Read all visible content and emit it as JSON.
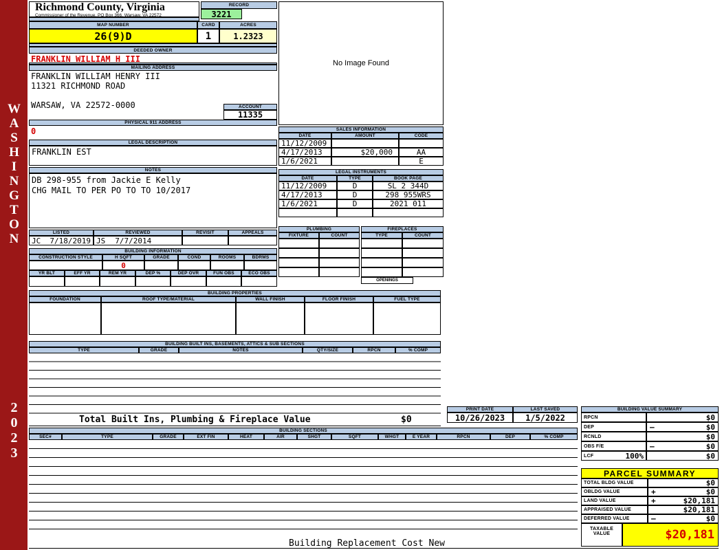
{
  "colors": {
    "header_blue": "#b8cce4",
    "record_green": "#9cf09c",
    "highlight_yellow": "#ffff00",
    "acres_cream": "#ffffcc",
    "sidebar_red": "#9b1717",
    "alert_red": "#d40000"
  },
  "sidebar": {
    "state": "WASHINGTON",
    "year": "2023"
  },
  "header": {
    "county": "Richmond County, Virginia",
    "commissioner": "Commissioner of the Revenue, PO Box 366, Warsaw, VA 22572"
  },
  "record": {
    "label": "RECORD",
    "value": "3221"
  },
  "map_number": {
    "label": "MAP NUMBER",
    "value": "26(9)D"
  },
  "card": {
    "label": "CARD",
    "value": "1"
  },
  "acres": {
    "label": "ACRES",
    "value": "1.2323"
  },
  "deeded_owner": {
    "label": "DEEDED OWNER",
    "value": "FRANKLIN WILLIAM H III"
  },
  "mailing_address": {
    "label": "MAILING ADDRESS",
    "line1": "FRANKLIN WILLIAM HENRY III",
    "line2": "11321 RICHMOND ROAD",
    "line3": "WARSAW, VA 22572-0000"
  },
  "account": {
    "label": "ACCOUNT",
    "value": "11335"
  },
  "physical_address": {
    "label": "PHYSICAL 911 ADDRESS",
    "value": "0"
  },
  "legal_description": {
    "label": "LEGAL DESCRIPTION",
    "value": "FRANKLIN EST"
  },
  "notes": {
    "label": "NOTES",
    "line1": "DB 298-955 from Jackie E Kelly",
    "line2": "CHG MAIL TO PER PO TO TO 10/2017"
  },
  "image_box": {
    "text": "No Image Found"
  },
  "sales": {
    "title": "SALES INFORMATION",
    "headers": [
      "DATE",
      "AMOUNT",
      "CODE"
    ],
    "rows": [
      {
        "date": "11/12/2009",
        "amount": "",
        "code": ""
      },
      {
        "date": "4/17/2013",
        "amount": "$20,000",
        "code": "AA"
      },
      {
        "date": "1/6/2021",
        "amount": "",
        "code": "E"
      }
    ]
  },
  "legal_instruments": {
    "title": "LEGAL INSTRUMENTS",
    "headers": [
      "DATE",
      "TYPE",
      "BOOK PAGE"
    ],
    "rows": [
      {
        "date": "11/12/2009",
        "type": "D",
        "book": "SL 2 344D"
      },
      {
        "date": "4/17/2013",
        "type": "D",
        "book": "298 955WRS"
      },
      {
        "date": "1/6/2021",
        "type": "D",
        "book": "2021 011"
      }
    ]
  },
  "plumbing": {
    "title": "PLUMBING",
    "headers": [
      "FIXTURE",
      "COUNT"
    ]
  },
  "fireplaces": {
    "title": "FIREPLACES",
    "headers": [
      "TYPE",
      "COUNT"
    ],
    "openings": "OPENINGS"
  },
  "inspection": {
    "headers": [
      "LISTED",
      "REVIEWED",
      "REVISIT",
      "APPEALS"
    ],
    "listed_by": "JC",
    "listed_date": "7/18/2019",
    "reviewed_by": "JS",
    "reviewed_date": "7/7/2014"
  },
  "building_information": {
    "title": "BUILDING INFORMATION",
    "row1_headers": [
      "CONSTRUCTION STYLE",
      "H SQFT",
      "GRADE",
      "COND",
      "ROOMS",
      "BDRMS"
    ],
    "h_sqft": "0",
    "row2_headers": [
      "YR BLT",
      "EFF YR",
      "REM YR",
      "DEP %",
      "DEP OVR",
      "FUN OBS",
      "ECO OBS"
    ]
  },
  "building_properties": {
    "title": "BUILDING PROPERTIES",
    "headers": [
      "FOUNDATION",
      "ROOF TYPE/MATERIAL",
      "WALL FINISH",
      "FLOOR FINISH",
      "FUEL TYPE"
    ]
  },
  "built_ins": {
    "title": "BUILDING BUILT INS, BASEMENTS, ATTICS & SUB SECTIONS",
    "headers": [
      "TYPE",
      "GRADE",
      "NOTES",
      "QTY/SIZE",
      "RPCN",
      "% COMP"
    ],
    "total_label": "Total Built Ins, Plumbing & Fireplace Value",
    "total_value": "$0"
  },
  "print_info": {
    "print_date_label": "PRINT DATE",
    "print_date": "10/26/2023",
    "last_saved_label": "LAST SAVED",
    "last_saved": "1/5/2022"
  },
  "building_value_summary": {
    "title": "BUILDING VALUE SUMMARY",
    "rows": [
      {
        "label": "RPCN",
        "extra": "",
        "op": "",
        "value": "$0"
      },
      {
        "label": "DEP",
        "extra": "",
        "op": "–",
        "value": "$0"
      },
      {
        "label": "RCNLD",
        "extra": "",
        "op": "",
        "value": "$0"
      },
      {
        "label": "OBS F/E",
        "extra": "",
        "op": "–",
        "value": "$0"
      },
      {
        "label": "LCF",
        "extra": "100%",
        "op": "",
        "value": "$0"
      }
    ]
  },
  "building_sections": {
    "title": "BUILDING SECTIONS",
    "headers": [
      "SEC#",
      "TYPE",
      "GRADE",
      "EXT FIN",
      "HEAT",
      "AIR",
      "SHGT",
      "SQFT",
      "WHGT",
      "E YEAR",
      "RPCN",
      "DEP",
      "% COMP"
    ]
  },
  "parcel_summary": {
    "title": "PARCEL SUMMARY",
    "rows": [
      {
        "label": "TOTAL BLDG VALUE",
        "op": "",
        "value": "$0"
      },
      {
        "label": "OBLDG VALUE",
        "op": "+",
        "value": "$0"
      },
      {
        "label": "LAND VALUE",
        "op": "+",
        "value": "$20,181"
      },
      {
        "label": "APPRAISED VALUE",
        "op": "",
        "value": "$20,181"
      },
      {
        "label": "DEFERRED VALUE",
        "op": "–",
        "value": "$0"
      }
    ],
    "taxable_label_1": "TAXABLE",
    "taxable_label_2": "VALUE",
    "taxable_value": "$20,181"
  },
  "footer": {
    "text": "Building Replacement Cost New"
  }
}
